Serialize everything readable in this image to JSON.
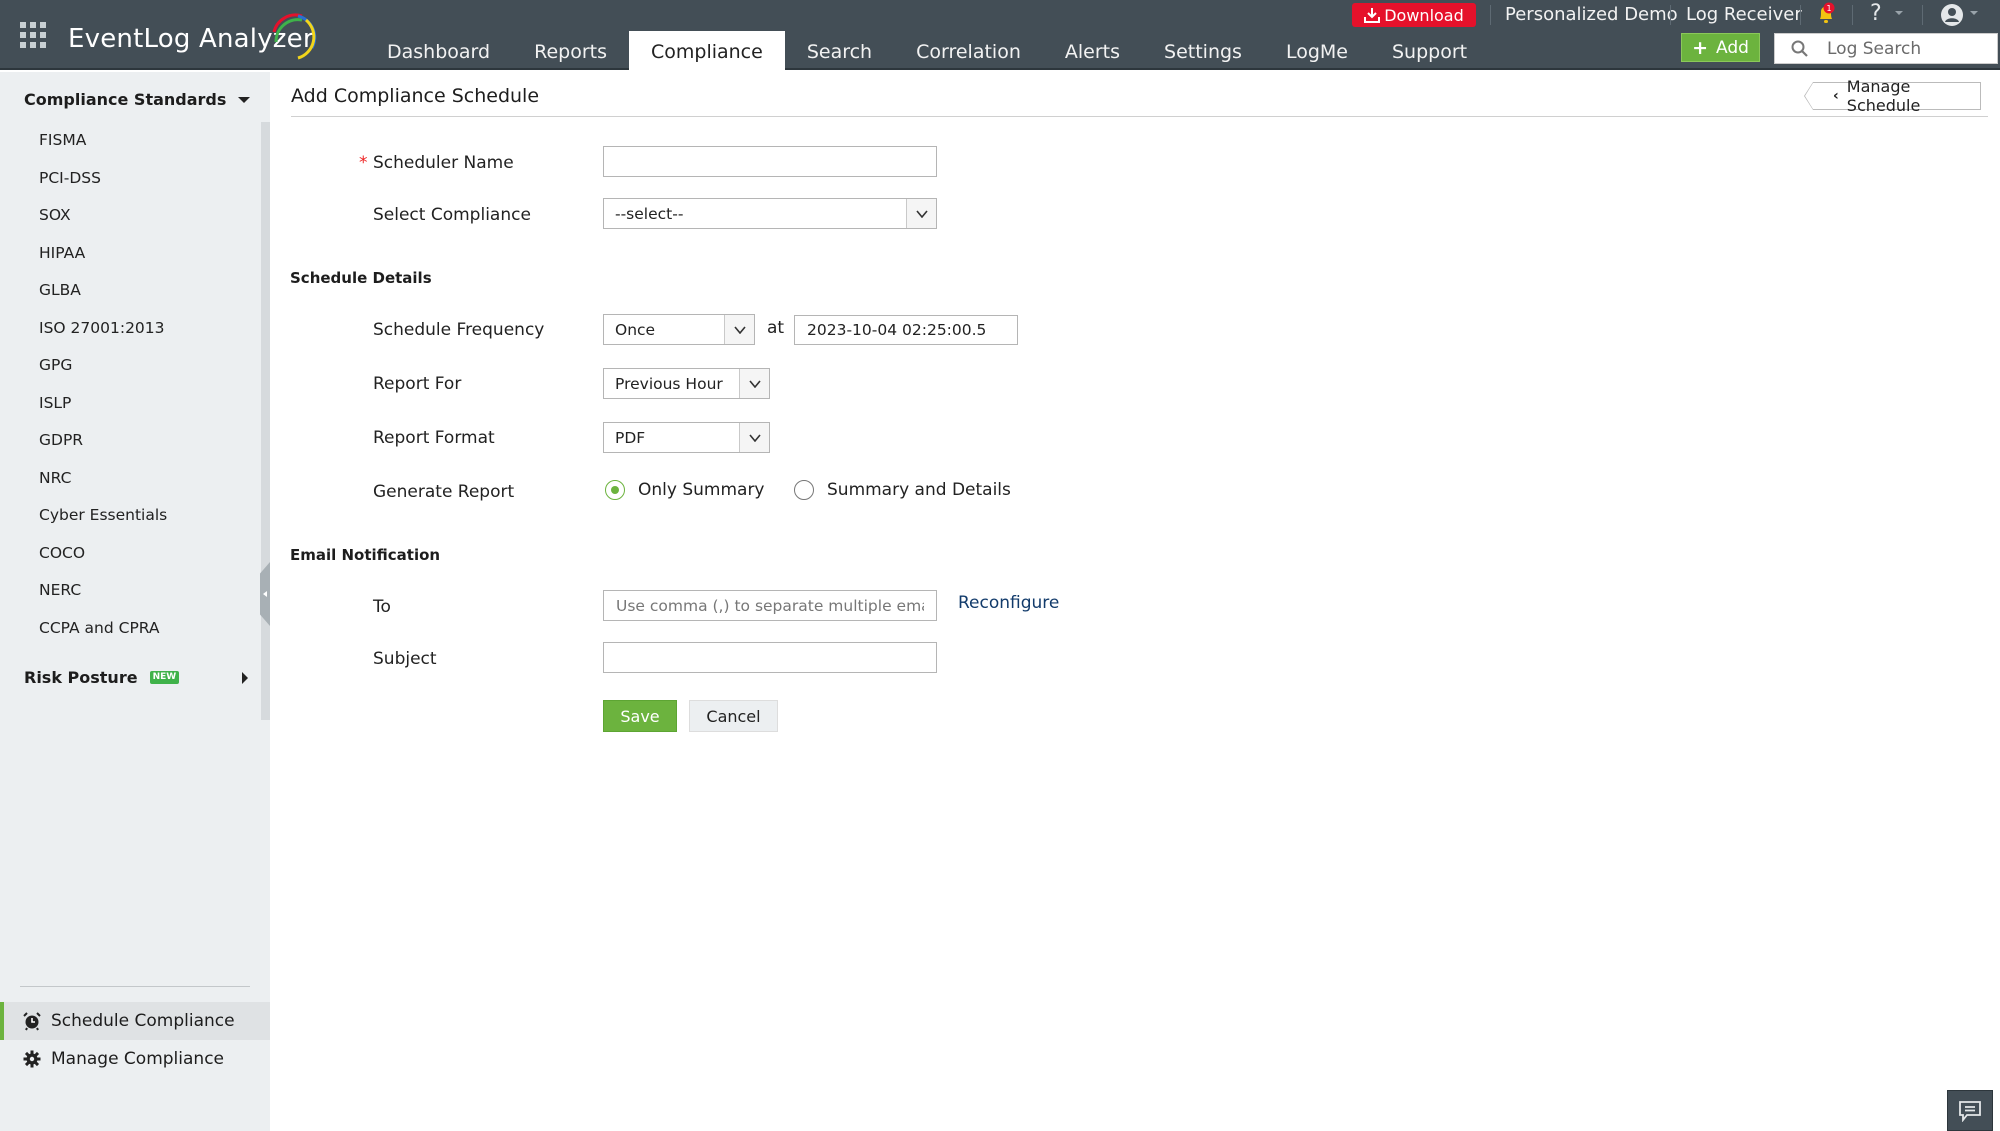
{
  "app": {
    "name": "EventLog Analyzer"
  },
  "nav": {
    "tabs": [
      {
        "label": "Dashboard",
        "active": false
      },
      {
        "label": "Reports",
        "active": false
      },
      {
        "label": "Compliance",
        "active": true
      },
      {
        "label": "Search",
        "active": false
      },
      {
        "label": "Correlation",
        "active": false
      },
      {
        "label": "Alerts",
        "active": false
      },
      {
        "label": "Settings",
        "active": false
      },
      {
        "label": "LogMe",
        "active": false
      },
      {
        "label": "Support",
        "active": false
      }
    ]
  },
  "topbar": {
    "download_label": "Download",
    "personalized_demo": "Personalized Demo",
    "log_receiver": "Log Receiver",
    "notification_count": "1",
    "help_glyph": "?",
    "add_label": "Add",
    "add_glyph": "+",
    "search_placeholder": "Log Search"
  },
  "sidebar": {
    "section_title": "Compliance Standards",
    "items": [
      {
        "label": "FISMA"
      },
      {
        "label": "PCI-DSS"
      },
      {
        "label": "SOX"
      },
      {
        "label": "HIPAA"
      },
      {
        "label": "GLBA"
      },
      {
        "label": "ISO 27001:2013"
      },
      {
        "label": "GPG"
      },
      {
        "label": "ISLP"
      },
      {
        "label": "GDPR"
      },
      {
        "label": "NRC"
      },
      {
        "label": "Cyber Essentials"
      },
      {
        "label": "COCO"
      },
      {
        "label": "NERC"
      },
      {
        "label": "CCPA and CPRA"
      }
    ],
    "risk_posture": "Risk Posture",
    "new_badge": "NEW",
    "bottom": [
      {
        "label": "Schedule Compliance",
        "icon": "alarm-clock-icon",
        "active": true
      },
      {
        "label": "Manage Compliance",
        "icon": "gear-icon",
        "active": false
      }
    ]
  },
  "page": {
    "title": "Add Compliance Schedule",
    "manage_schedule": "Manage Schedule",
    "manage_chevron": "‹"
  },
  "form": {
    "required_mark": "*",
    "scheduler_name": {
      "label": "Scheduler Name",
      "value": ""
    },
    "select_compliance": {
      "label": "Select Compliance",
      "value": "--select--"
    },
    "schedule_details_title": "Schedule Details",
    "schedule_frequency": {
      "label": "Schedule Frequency",
      "value": "Once",
      "at_label": "at",
      "datetime": "2023-10-04 02:25:00.5"
    },
    "report_for": {
      "label": "Report For",
      "value": "Previous Hour"
    },
    "report_format": {
      "label": "Report Format",
      "value": "PDF"
    },
    "generate_report": {
      "label": "Generate Report",
      "options": [
        {
          "label": "Only Summary",
          "checked": true
        },
        {
          "label": "Summary and Details",
          "checked": false
        }
      ]
    },
    "email_title": "Email Notification",
    "to": {
      "label": "To",
      "value": "",
      "placeholder": "Use comma (,) to separate multiple email addresses"
    },
    "reconfigure": "Reconfigure",
    "subject": {
      "label": "Subject",
      "value": ""
    },
    "save": "Save",
    "cancel": "Cancel"
  },
  "colors": {
    "header_bg": "#434e56",
    "accent_green": "#6cb33e",
    "download_red": "#e5112b",
    "link_blue": "#123b6b",
    "sidebar_bg": "#eceff1"
  }
}
